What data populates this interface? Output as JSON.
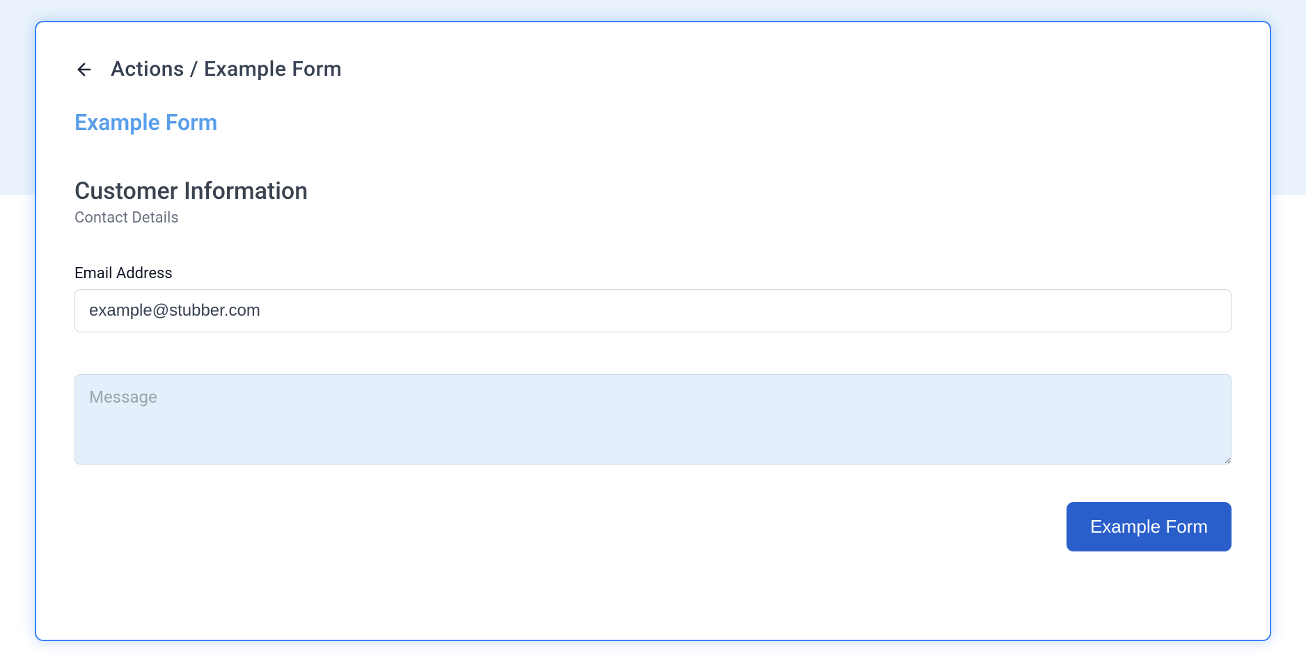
{
  "header": {
    "breadcrumb": "Actions / Example Form"
  },
  "form": {
    "title": "Example Form",
    "section_title": "Customer Information",
    "section_subtitle": "Contact Details",
    "email_label": "Email Address",
    "email_value": "example@stubber.com",
    "message_placeholder": "Message",
    "message_value": "",
    "submit_label": "Example Form"
  }
}
